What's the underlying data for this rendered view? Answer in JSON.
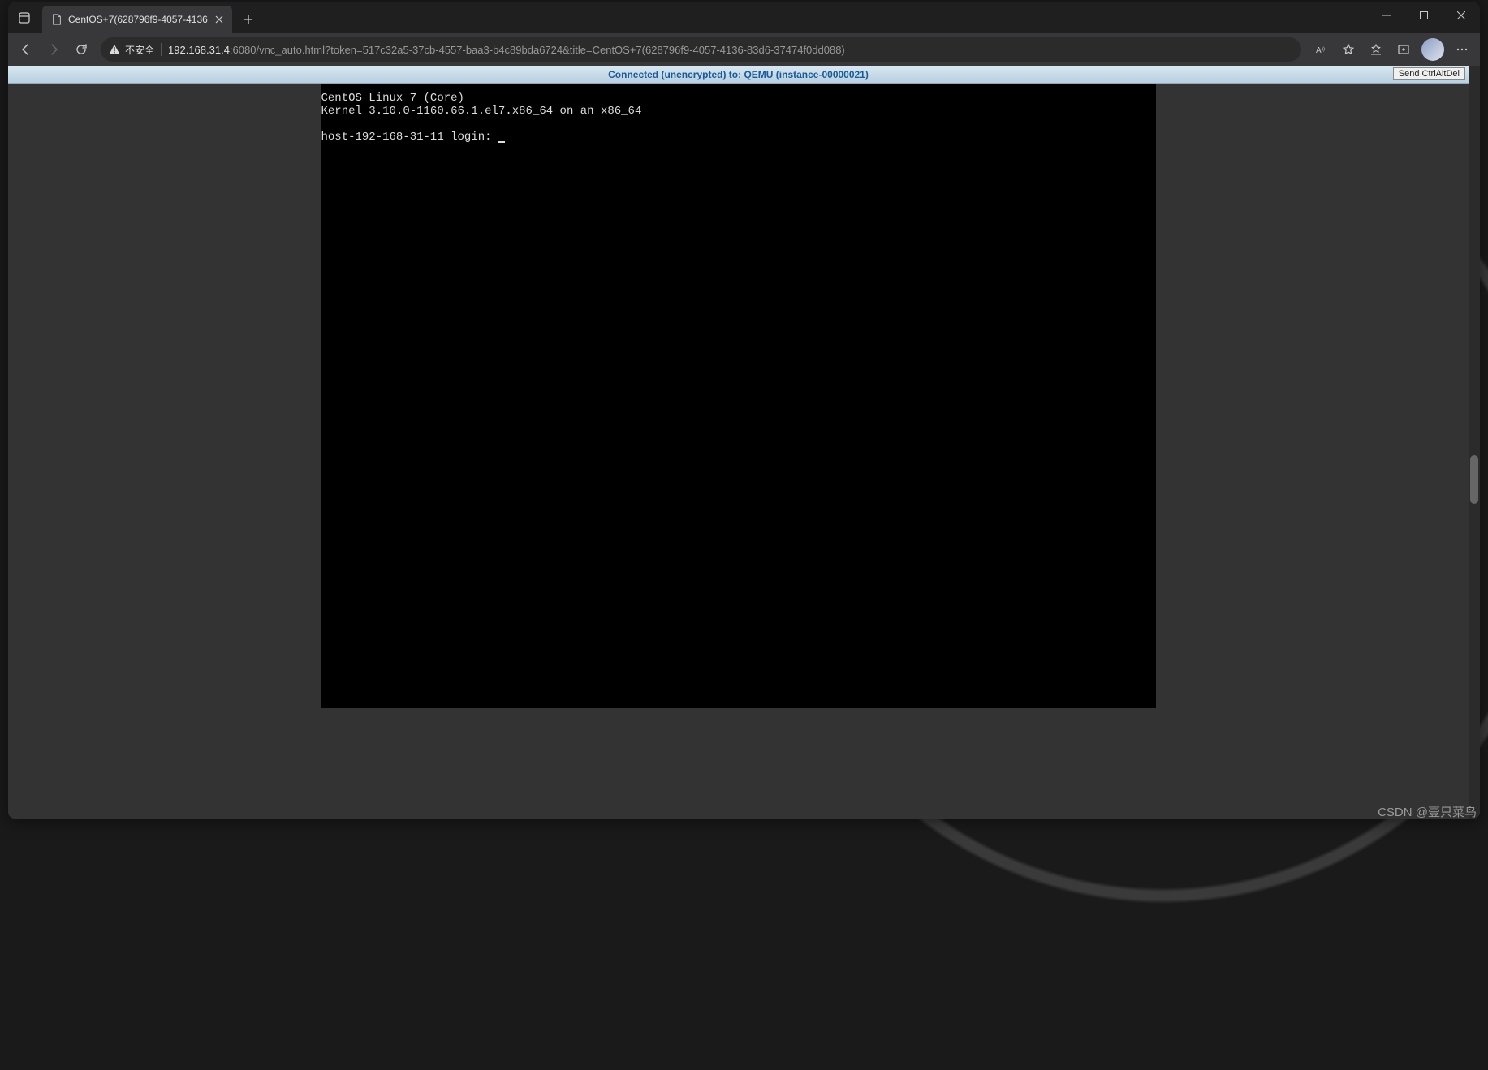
{
  "browser": {
    "tab": {
      "title": "CentOS+7(628796f9-4057-4136",
      "favicon": "document-icon"
    },
    "security_label": "不安全",
    "url_host": "192.168.31.4",
    "url_path": ":6080/vnc_auto.html?token=517c32a5-37cb-4557-baa3-b4c89bda6724&title=CentOS+7(628796f9-4057-4136-83d6-37474f0dd088)"
  },
  "vnc": {
    "status_text": "Connected (unencrypted) to: QEMU (instance-00000021)",
    "send_cad_label": "Send CtrlAltDel",
    "console_line1": "CentOS Linux 7 (Core)",
    "console_line2": "Kernel 3.10.0-1160.66.1.el7.x86_64 on an x86_64",
    "console_login": "host-192-168-31-11 login: "
  },
  "watermark": "CSDN @壹只菜鸟"
}
